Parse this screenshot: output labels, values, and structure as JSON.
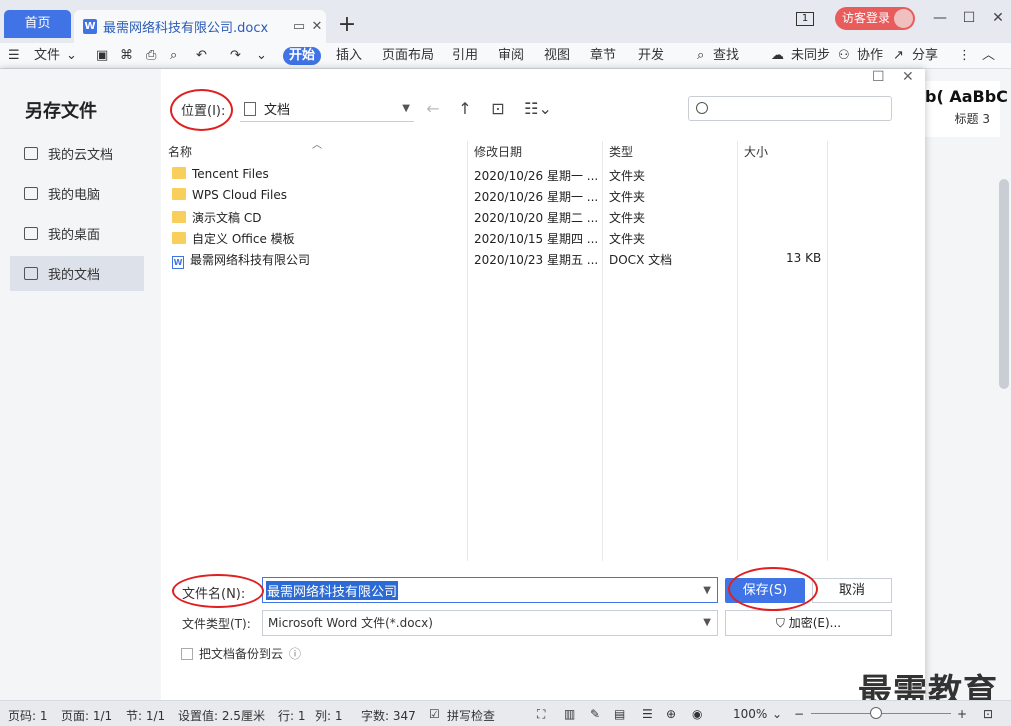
{
  "tabs": {
    "home": "首页",
    "doc": "最需网络科技有限公司.docx",
    "add": "+"
  },
  "window": {
    "page_indicator": "1",
    "login": "访客登录",
    "minimize": "—",
    "restore": "☐",
    "close": "✕"
  },
  "toolbar": {
    "file": "文件",
    "start": "开始",
    "insert": "插入",
    "layout": "页面布局",
    "reference": "引用",
    "review": "审阅",
    "view": "视图",
    "chapter": "章节",
    "dev": "开发",
    "find": "查找",
    "unsync": "未同步",
    "collab": "协作",
    "share": "分享"
  },
  "styles": {
    "preview": "b( AaBbC",
    "heading3": "标题 3"
  },
  "dialog": {
    "title": "另存文件",
    "nav": [
      {
        "label": "我的云文档"
      },
      {
        "label": "我的电脑"
      },
      {
        "label": "我的桌面"
      },
      {
        "label": "我的文档"
      }
    ],
    "location_label": "位置(I):",
    "location_value": "文档",
    "search_placeholder": ""
  },
  "columns": {
    "name": "名称",
    "date": "修改日期",
    "type": "类型",
    "size": "大小"
  },
  "files": [
    {
      "name": "Tencent Files",
      "date": "2020/10/26 星期一 ...",
      "type": "文件夹",
      "size": "",
      "kind": "folder"
    },
    {
      "name": "WPS Cloud Files",
      "date": "2020/10/26 星期一 ...",
      "type": "文件夹",
      "size": "",
      "kind": "folder"
    },
    {
      "name": "演示文稿 CD",
      "date": "2020/10/20 星期二 ...",
      "type": "文件夹",
      "size": "",
      "kind": "folder"
    },
    {
      "name": "自定义 Office 模板",
      "date": "2020/10/15 星期四 ...",
      "type": "文件夹",
      "size": "",
      "kind": "folder"
    },
    {
      "name": "最需网络科技有限公司",
      "date": "2020/10/23 星期五 ...",
      "type": "DOCX 文档",
      "size": "13 KB",
      "kind": "docx"
    }
  ],
  "form": {
    "filename_label": "文件名(N):",
    "filename_value": "最需网络科技有限公司",
    "filetype_label": "文件类型(T):",
    "filetype_value": "Microsoft Word 文件(*.docx)",
    "save": "保存(S)",
    "cancel": "取消",
    "encrypt": "加密(E)...",
    "backup": "把文档备份到云"
  },
  "status": {
    "page": "页码: 1",
    "pages": "页面: 1/1",
    "section": "节: 1/1",
    "setting": "设置值: 2.5厘米",
    "line": "行: 1",
    "col": "列: 1",
    "words": "字数: 347",
    "spell": "拼写检查",
    "zoom": "100%"
  },
  "watermark": "最需教育"
}
